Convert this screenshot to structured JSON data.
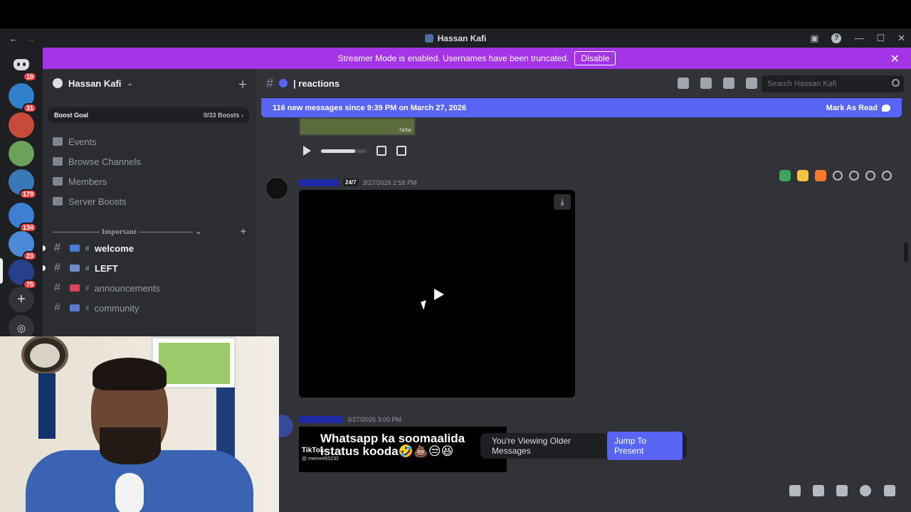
{
  "window": {
    "title": "Hassan Kafi",
    "back_glyph": "←",
    "forward_glyph": "→",
    "help_glyph": "?",
    "minimize_glyph": "—",
    "maximize_glyph": "☐",
    "close_glyph": "✕"
  },
  "servers": [
    {
      "badge": "19"
    },
    {
      "badge": "31"
    },
    {
      "badge": ""
    },
    {
      "badge": ""
    },
    {
      "badge": "179"
    },
    {
      "badge": "134"
    },
    {
      "badge": "23"
    },
    {
      "badge": "75"
    }
  ],
  "rail": {
    "add_glyph": "+"
  },
  "streamer_banner": {
    "text": "Streamer Mode is enabled. Usernames have been truncated.",
    "button": "Disable",
    "close_glyph": "✕"
  },
  "guild": {
    "name": "Hassan Kafi",
    "caret": "⌄",
    "invite_glyph": "＋",
    "boost_label": "Boost Goal",
    "boost_value": "0/33 Boosts ›"
  },
  "nav": [
    {
      "label": "Events"
    },
    {
      "label": "Browse Channels"
    },
    {
      "label": "Members"
    },
    {
      "label": "Server Boosts"
    }
  ],
  "category": {
    "label": "——————  Important  ——————— ⌄",
    "add_glyph": "+"
  },
  "channels": [
    {
      "name": "welcome",
      "unread": true,
      "color": "#4a7bd6"
    },
    {
      "name": "LEFT",
      "unread": true,
      "color": "#6d8fc8"
    },
    {
      "name": "announcements",
      "unread": false,
      "color": "#e0425b"
    },
    {
      "name": "community",
      "unread": false,
      "color": "#5a7ad0"
    }
  ],
  "channel_glyphs": {
    "hash": "#",
    "bar": "ıl"
  },
  "header": {
    "hash": "#",
    "channel": "| reactions",
    "search_placeholder": "Search Hassan Kafi"
  },
  "new_messages_bar": {
    "text": "116 new messages since 9:39 PM on March 27, 2026",
    "action": "Mark As Read"
  },
  "thumbnail": {
    "brand": "TikTok"
  },
  "messages": [
    {
      "author": "",
      "tag": "24/7",
      "timestamp": "3/27/2026 2:58 PM",
      "download_glyph": "⤓"
    },
    {
      "author": "",
      "tag": "",
      "timestamp": "3/27/2026 3:00 PM",
      "embed": {
        "caption": "Whatsapp ka soomaalida istatus kooda🤣💩😒😆",
        "brand": "TikTok",
        "handle": "@ meme455232"
      }
    }
  ],
  "older_notice": {
    "text": "You're Viewing Older Messages",
    "button": "Jump To Present"
  },
  "colors": {
    "streamer_banner": "#a335e6",
    "blurple": "#5865f2",
    "danger": "#f23f43",
    "background": "#313338",
    "sidebar": "#2b2d31",
    "rail": "#1e1f22"
  },
  "icons": {
    "hover_reactions": [
      "check-emoji",
      "laughing-emoji",
      "fire-emoji"
    ],
    "hover_actions": [
      "add-reaction-icon",
      "reply-icon",
      "forward-icon",
      "more-icon"
    ],
    "composer": [
      "gift-icon",
      "gif-icon",
      "sticker-icon",
      "emoji-icon",
      "apps-icon"
    ]
  }
}
